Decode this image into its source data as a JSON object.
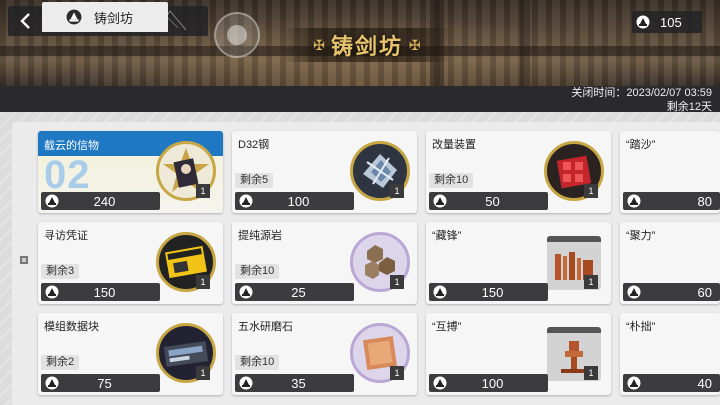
{
  "header": {
    "title": "铸剑坊",
    "currency_value": "105",
    "icons": {
      "back": "back-arrow-icon",
      "home": "home-icon",
      "currency": "forge-token-icon"
    }
  },
  "tab": {
    "label": "铸剑坊"
  },
  "close_info": {
    "line1": "关闭时间：2023/02/07 03:59",
    "line2": "剩余12天"
  },
  "items": [
    {
      "name": "截云的信物",
      "badge": "02",
      "stock": "",
      "price": "240",
      "qty": "1",
      "featured": true
    },
    {
      "name": "D32钢",
      "stock": "剩余5",
      "price": "100",
      "qty": "1"
    },
    {
      "name": "改量装置",
      "stock": "剩余10",
      "price": "50",
      "qty": "1"
    },
    {
      "name": "“踏沙”",
      "stock": "",
      "price": "80",
      "qty": ""
    },
    {
      "name": "寻访凭证",
      "stock": "剩余3",
      "price": "150",
      "qty": "1"
    },
    {
      "name": "提纯源岩",
      "stock": "剩余10",
      "price": "25",
      "qty": "1"
    },
    {
      "name": "“藏锋”",
      "stock": "",
      "price": "150",
      "qty": "1"
    },
    {
      "name": "“聚力”",
      "stock": "",
      "price": "60",
      "qty": ""
    },
    {
      "name": "模组数据块",
      "stock": "剩余2",
      "price": "75",
      "qty": "1"
    },
    {
      "name": "五水研磨石",
      "stock": "剩余10",
      "price": "35",
      "qty": "1"
    },
    {
      "name": "“互搏”",
      "stock": "",
      "price": "100",
      "qty": "1"
    },
    {
      "name": "“朴拙”",
      "stock": "",
      "price": "40",
      "qty": ""
    }
  ],
  "colors": {
    "accent_blue": "#1f78c2",
    "gold": "#c7a744",
    "dark": "#3c3c3e"
  }
}
